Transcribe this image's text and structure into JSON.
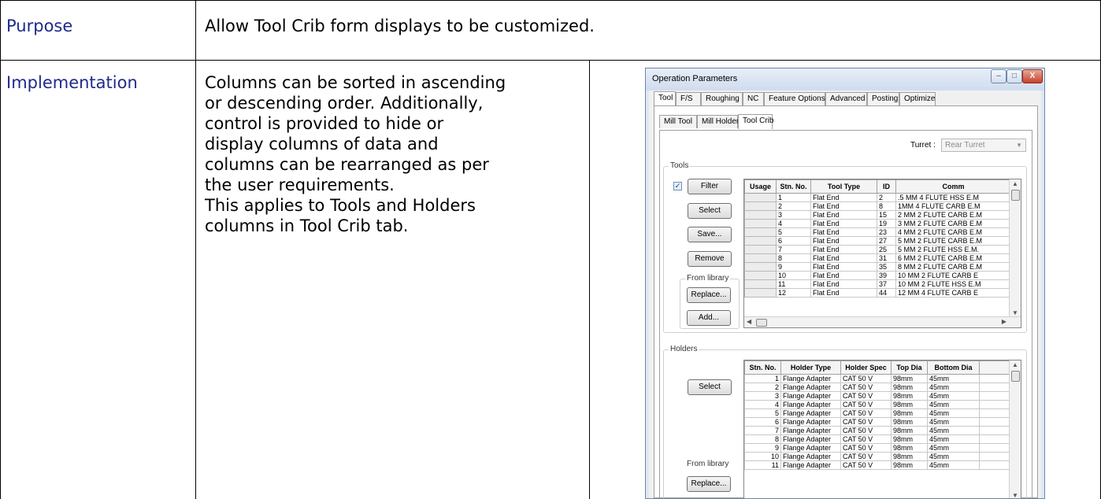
{
  "rows": [
    {
      "label": "Purpose",
      "text": "Allow Tool Crib form displays to be customized."
    },
    {
      "label": "Implementation",
      "lines": [
        "Columns can be sorted in ascending",
        "or descending order.  Additionally,",
        "control is provided to hide or",
        "display columns of data and",
        "columns can be rearranged as per",
        "the user requirements.",
        "This applies to Tools and Holders",
        "columns in Tool Crib tab."
      ]
    }
  ],
  "dialog": {
    "title": "Operation Parameters",
    "window_buttons": {
      "minimize": "–",
      "maximize": "□",
      "close": "X"
    },
    "main_tabs": [
      "Tool",
      "F/S",
      "Roughing",
      "NC",
      "Feature Options",
      "Advanced",
      "Posting",
      "Optimize"
    ],
    "sub_tabs": [
      "Mill Tool",
      "Mill Holder",
      "Tool Crib"
    ],
    "turret_label": "Turret :",
    "turret_value": "Rear Turret",
    "tools_group": "Tools",
    "filter_label": "Filter",
    "filter_checked": "✓",
    "select_label": "Select",
    "save_label": "Save...",
    "remove_label": "Remove",
    "from_library_label": "From library",
    "replace_label": "Replace...",
    "add_label": "Add...",
    "tools_columns": [
      "Usage",
      "Stn. No.",
      "Tool Type",
      "ID",
      "Comm"
    ],
    "tools_rows": [
      [
        "",
        "1",
        "Flat End",
        "2",
        ".5 MM 4 FLUTE HSS E.M"
      ],
      [
        "",
        "2",
        "Flat End",
        "8",
        "1MM 4 FLUTE CARB E.M"
      ],
      [
        "",
        "3",
        "Flat End",
        "15",
        "2 MM 2 FLUTE CARB E.M"
      ],
      [
        "",
        "4",
        "Flat End",
        "19",
        "3 MM 2 FLUTE CARB E.M"
      ],
      [
        "",
        "5",
        "Flat End",
        "23",
        "4 MM 2 FLUTE CARB E.M"
      ],
      [
        "",
        "6",
        "Flat End",
        "27",
        "5 MM 2 FLUTE CARB E.M"
      ],
      [
        "",
        "7",
        "Flat End",
        "25",
        "5 MM 2 FLUTE HSS E.M."
      ],
      [
        "",
        "8",
        "Flat End",
        "31",
        "6 MM 2 FLUTE CARB E.M"
      ],
      [
        "",
        "9",
        "Flat End",
        "35",
        "8 MM 2 FLUTE CARB E.M"
      ],
      [
        "",
        "10",
        "Flat End",
        "39",
        "10 MM 2 FLUTE CARB E"
      ],
      [
        "",
        "11",
        "Flat End",
        "37",
        "10 MM 2 FLUTE HSS E.M"
      ],
      [
        "",
        "12",
        "Flat End",
        "44",
        "12 MM 4 FLUTE CARB E"
      ]
    ],
    "holders_group": "Holders",
    "holders_select_label": "Select",
    "holders_from_library": "From library",
    "holders_replace_label": "Replace...",
    "holders_columns": [
      "Stn. No.",
      "Holder Type",
      "Holder Spec",
      "Top Dia",
      "Bottom Dia"
    ],
    "holders_rows": [
      [
        "1",
        "Flange Adapter",
        "CAT 50 V",
        "98mm",
        "45mm"
      ],
      [
        "2",
        "Flange Adapter",
        "CAT 50 V",
        "98mm",
        "45mm"
      ],
      [
        "3",
        "Flange Adapter",
        "CAT 50 V",
        "98mm",
        "45mm"
      ],
      [
        "4",
        "Flange Adapter",
        "CAT 50 V",
        "98mm",
        "45mm"
      ],
      [
        "5",
        "Flange Adapter",
        "CAT 50 V",
        "98mm",
        "45mm"
      ],
      [
        "6",
        "Flange Adapter",
        "CAT 50 V",
        "98mm",
        "45mm"
      ],
      [
        "7",
        "Flange Adapter",
        "CAT 50 V",
        "98mm",
        "45mm"
      ],
      [
        "8",
        "Flange Adapter",
        "CAT 50 V",
        "98mm",
        "45mm"
      ],
      [
        "9",
        "Flange Adapter",
        "CAT 50 V",
        "98mm",
        "45mm"
      ],
      [
        "10",
        "Flange Adapter",
        "CAT 50 V",
        "98mm",
        "45mm"
      ],
      [
        "11",
        "Flange Adapter",
        "CAT 50 V",
        "98mm",
        "45mm"
      ]
    ]
  }
}
